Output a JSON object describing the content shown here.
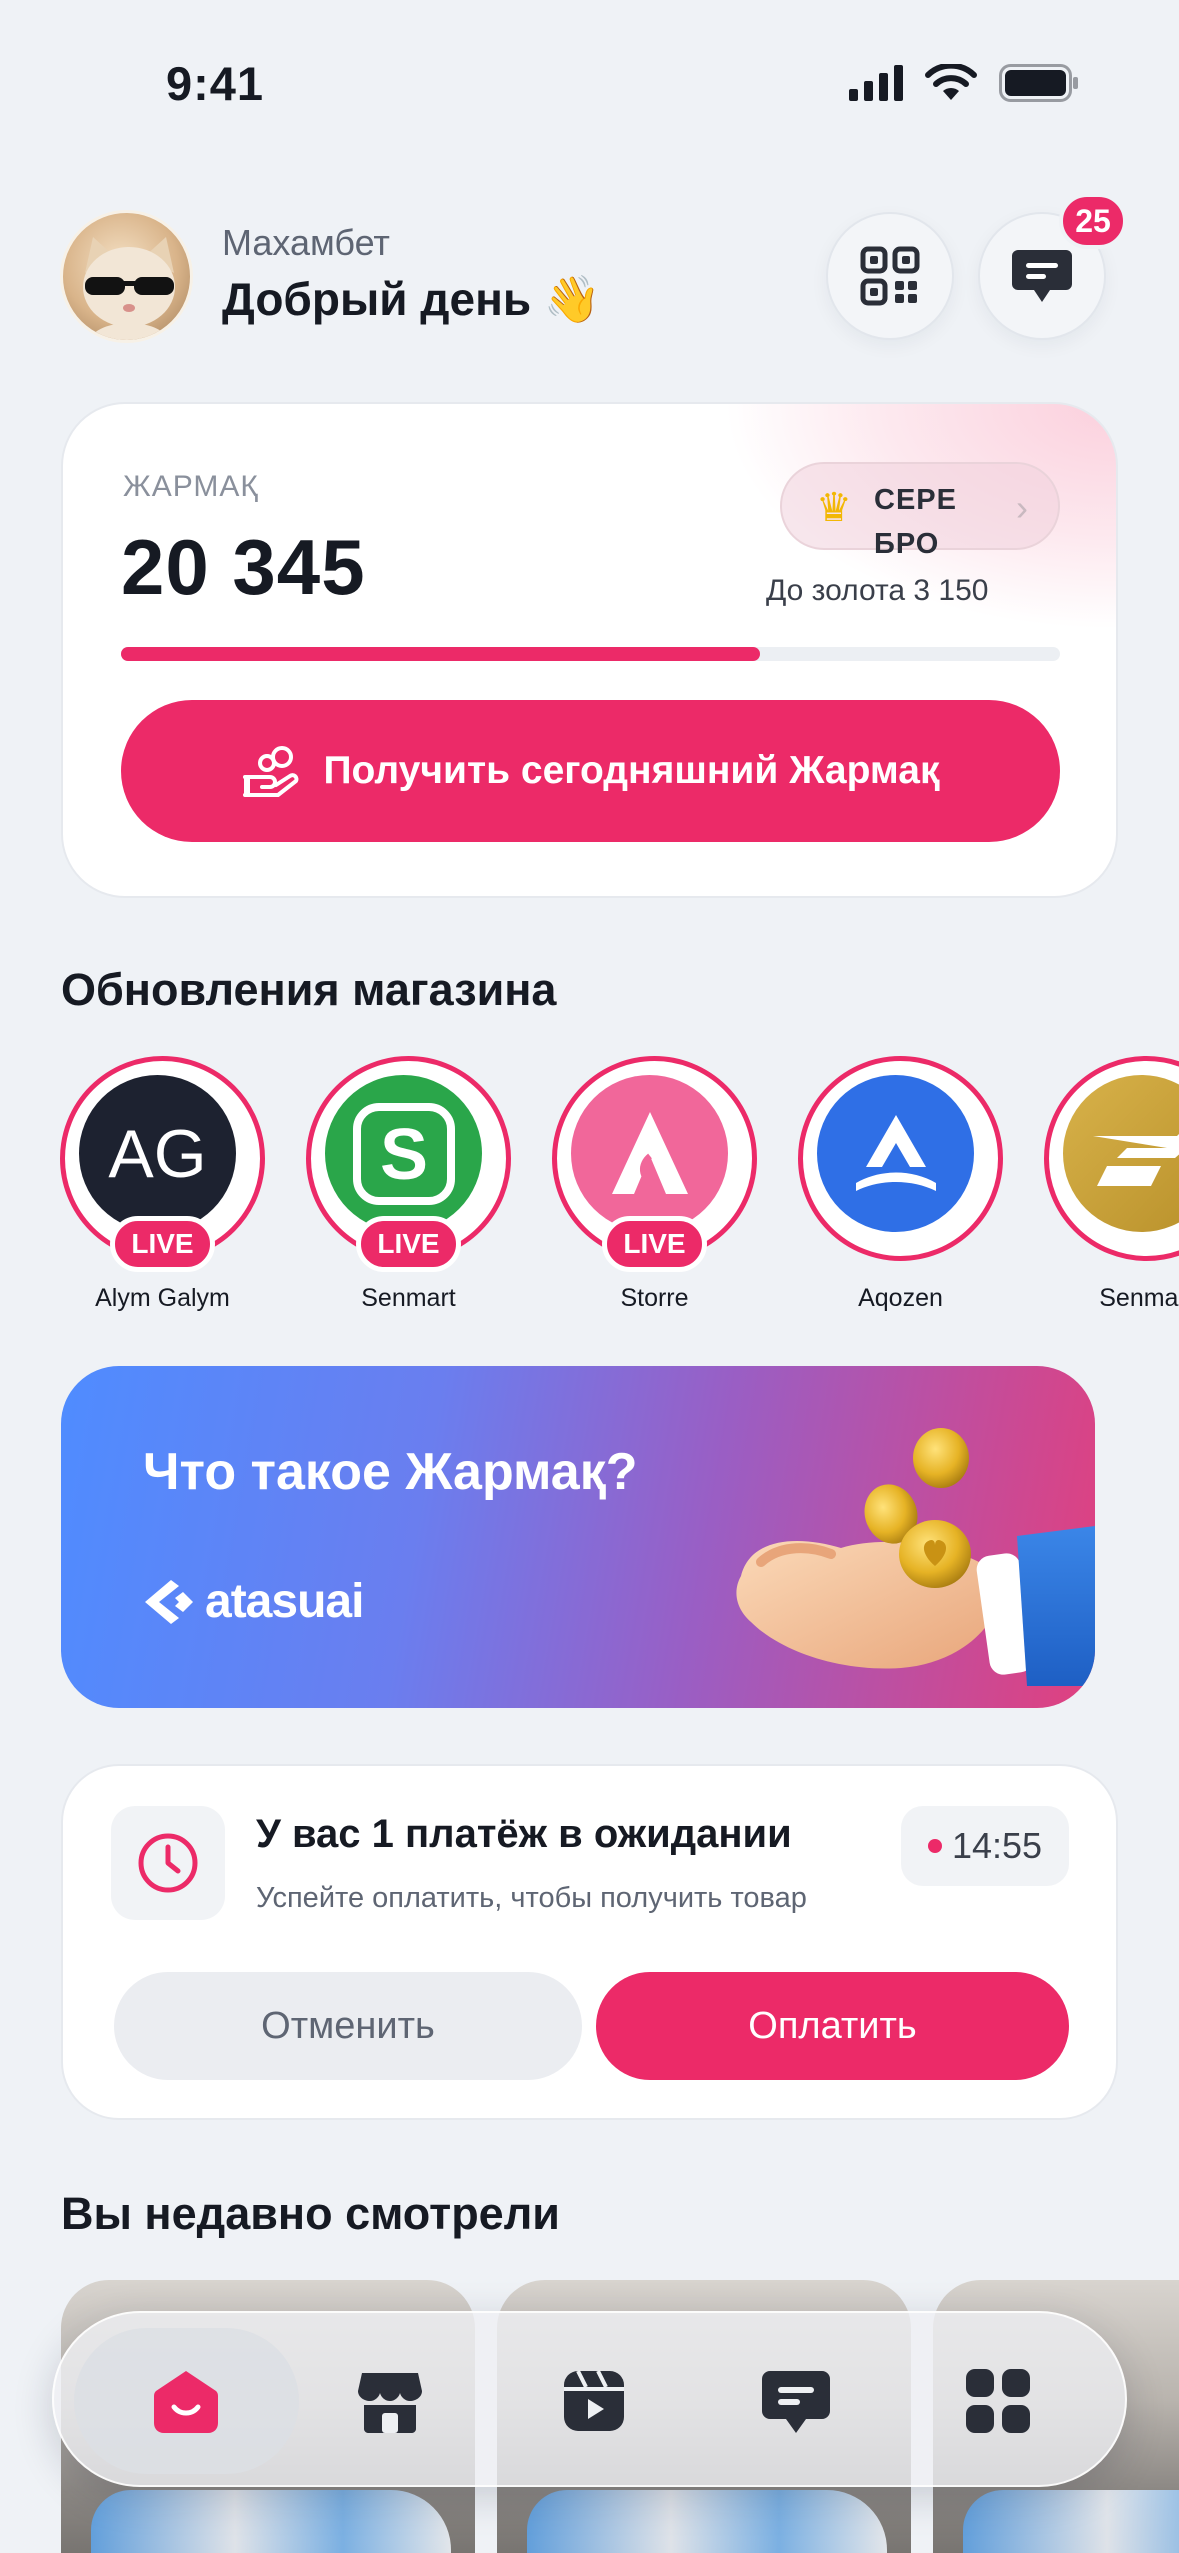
{
  "status_bar": {
    "time": "9:41"
  },
  "header": {
    "user_name": "Махамбет",
    "greeting": "Добрый день 👋",
    "messages_badge": "25"
  },
  "loyalty": {
    "label": "ЖАРМАҚ",
    "points": "20 345",
    "tier_line1": "СЕРЕ",
    "tier_line2": "БРО",
    "to_next_tier": "До золота 3 150",
    "progress": 0.68,
    "claim_button": "Получить сегодняшний Жармақ"
  },
  "store_updates": {
    "title": "Обновления магазина",
    "stories": [
      {
        "name": "Alym Galym",
        "initials": "AG",
        "live": "LIVE"
      },
      {
        "name": "Senmart",
        "live": "LIVE"
      },
      {
        "name": "Storre",
        "live": "LIVE"
      },
      {
        "name": "Aqozen"
      },
      {
        "name": "Senmart"
      }
    ]
  },
  "promo": {
    "title": "Что такое Жармақ?",
    "brand": "atasuai"
  },
  "pending_payment": {
    "title": "У вас 1 платёж в ожидании",
    "subtitle": "Успейте оплатить, чтобы получить товар",
    "timer": "14:55",
    "cancel_label": "Отменить",
    "pay_label": "Оплатить"
  },
  "recent": {
    "title": "Вы недавно смотрели"
  },
  "colors": {
    "accent": "#ec2a68",
    "background": "#eff2f6",
    "text": "#161a23"
  },
  "tab_bar": {
    "items": [
      "home-icon",
      "store-icon",
      "video-icon",
      "chat-icon",
      "grid-icon"
    ],
    "active": 0
  }
}
